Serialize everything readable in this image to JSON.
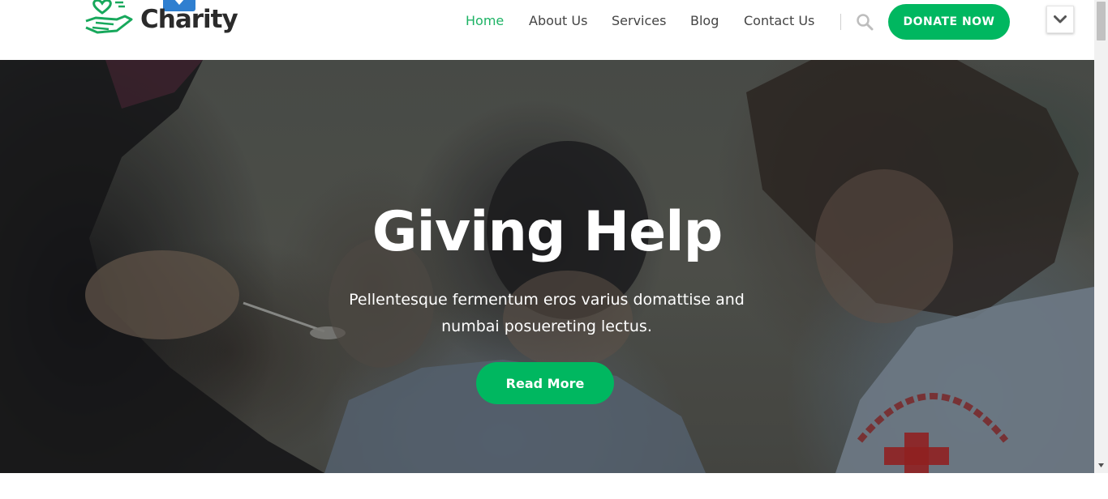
{
  "brand": {
    "name": "Charity",
    "accent": "#00b760",
    "dark_text": "#2b2b2b"
  },
  "header": {
    "logo_icon": "hand-heart-icon",
    "badge_icon": "chevron-down-icon",
    "nav": [
      {
        "label": "Home",
        "active": true
      },
      {
        "label": "About Us",
        "active": false
      },
      {
        "label": "Services",
        "active": false
      },
      {
        "label": "Blog",
        "active": false
      },
      {
        "label": "Contact Us",
        "active": false
      }
    ],
    "search_icon": "search-icon",
    "donate_label": "DONATE NOW",
    "toggle_icon": "chevron-down-icon"
  },
  "hero": {
    "title": "Giving Help",
    "subtitle": "Pellentesque fermentum eros varius domattise and numbai posuereting lectus.",
    "button_label": "Read More"
  }
}
